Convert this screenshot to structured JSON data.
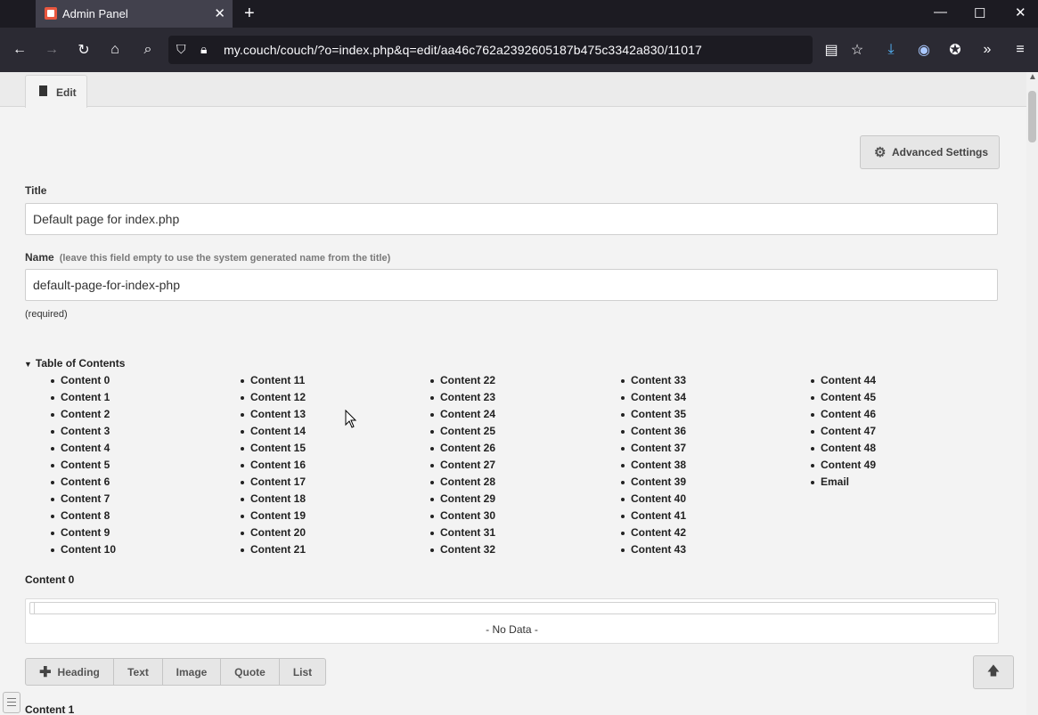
{
  "browser": {
    "tab_title": "Admin Panel",
    "url": "my.couch/couch/?o=index.php&q=edit/aa46c762a2392605187b475c3342a830/11017"
  },
  "tabs": {
    "edit_label": "Edit"
  },
  "buttons": {
    "advanced_settings": "Advanced Settings"
  },
  "form": {
    "title_label": "Title",
    "title_value": "Default page for index.php",
    "name_label": "Name",
    "name_hint": "(leave this field empty to use the system generated name from the title)",
    "name_value": "default-page-for-index-php",
    "required_note": "(required)"
  },
  "toc": {
    "title": "Table of Contents",
    "columns": [
      [
        "Content 0",
        "Content 1",
        "Content 2",
        "Content 3",
        "Content 4",
        "Content 5",
        "Content 6",
        "Content 7",
        "Content 8",
        "Content 9",
        "Content 10"
      ],
      [
        "Content 11",
        "Content 12",
        "Content 13",
        "Content 14",
        "Content 15",
        "Content 16",
        "Content 17",
        "Content 18",
        "Content 19",
        "Content 20",
        "Content 21"
      ],
      [
        "Content 22",
        "Content 23",
        "Content 24",
        "Content 25",
        "Content 26",
        "Content 27",
        "Content 28",
        "Content 29",
        "Content 30",
        "Content 31",
        "Content 32"
      ],
      [
        "Content 33",
        "Content 34",
        "Content 35",
        "Content 36",
        "Content 37",
        "Content 38",
        "Content 39",
        "Content 40",
        "Content 41",
        "Content 42",
        "Content 43"
      ],
      [
        "Content 44",
        "Content 45",
        "Content 46",
        "Content 47",
        "Content 48",
        "Content 49",
        "Email"
      ]
    ]
  },
  "content0": {
    "label": "Content 0",
    "no_data": "- No Data -",
    "add_buttons": [
      "Heading",
      "Text",
      "Image",
      "Quote",
      "List"
    ]
  },
  "content1": {
    "label": "Content 1"
  }
}
